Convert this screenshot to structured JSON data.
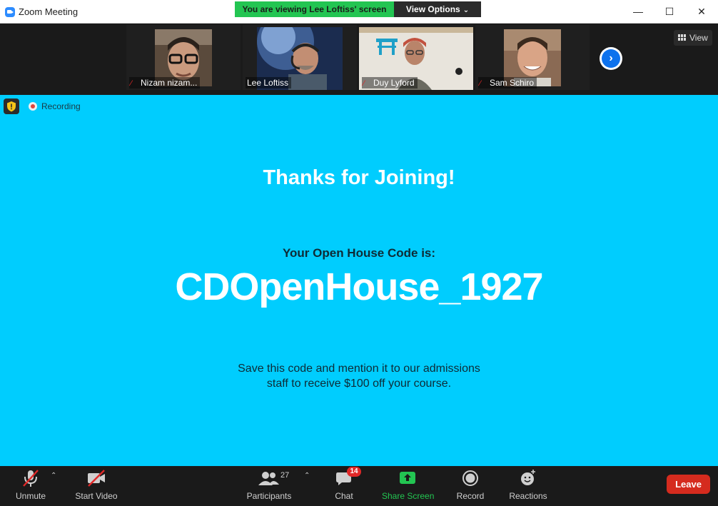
{
  "window": {
    "title": "Zoom Meeting",
    "viewing_banner": "You are viewing Lee Loftiss' screen",
    "view_options": "View Options",
    "minimize": "—",
    "maximize": "☐",
    "close": "✕"
  },
  "participants_strip": {
    "tiles": [
      {
        "name": "Nizam nizam...",
        "muted": true
      },
      {
        "name": "Lee Loftiss",
        "muted": false
      },
      {
        "name": "Duy Lyford",
        "muted": true
      },
      {
        "name": "Sam Schiro",
        "muted": true
      }
    ],
    "view_label": "View"
  },
  "screen": {
    "recording_label": "Recording",
    "title": "Thanks for Joining!",
    "subtitle": "Your Open House Code is:",
    "code": "CDOpenHouse_1927",
    "body_line1": "Save this code and mention it to our admissions",
    "body_line2": "staff to receive $100 off your course."
  },
  "toolbar": {
    "unmute": "Unmute",
    "start_video": "Start Video",
    "participants": "Participants",
    "participants_count": "27",
    "chat": "Chat",
    "chat_badge": "14",
    "share_screen": "Share Screen",
    "record": "Record",
    "reactions": "Reactions",
    "leave": "Leave"
  },
  "colors": {
    "screen_bg": "#00cdfe",
    "banner_green": "#23c552",
    "leave_red": "#d52b1e",
    "zoom_blue": "#0e72ed"
  }
}
